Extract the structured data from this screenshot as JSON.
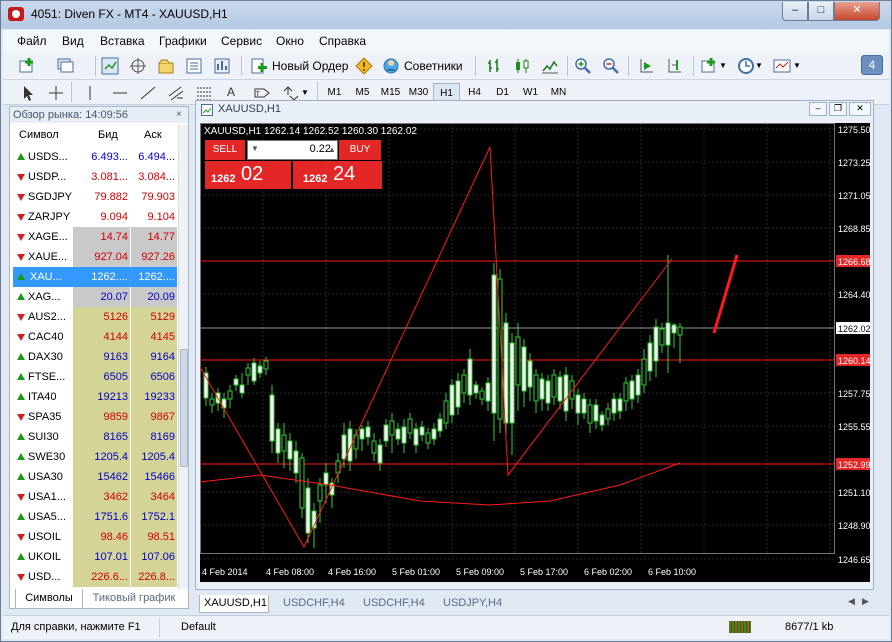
{
  "window": {
    "title": "4051: Diven FX - MT4 - XAUUSD,H1"
  },
  "menu": [
    "Файл",
    "Вид",
    "Вставка",
    "Графики",
    "Сервис",
    "Окно",
    "Справка"
  ],
  "toolbar": {
    "new_order": "Новый Ордер",
    "advisors": "Советники",
    "notifications_count": "4"
  },
  "timeframes": [
    "M1",
    "M5",
    "M15",
    "M30",
    "H1",
    "H4",
    "D1",
    "W1",
    "MN"
  ],
  "active_timeframe": "H1",
  "market_watch": {
    "header": "Обзор рынка: 14:09:56",
    "columns": {
      "symbol": "Символ",
      "bid": "Бид",
      "ask": "Аск"
    },
    "rows": [
      {
        "symbol": "USDS...",
        "bid": "6.493...",
        "ask": "6.494...",
        "dir": "up",
        "bg": "#ffffff",
        "color": "#0000cc"
      },
      {
        "symbol": "USDP...",
        "bid": "3.081...",
        "ask": "3.084...",
        "dir": "down",
        "bg": "#ffffff",
        "color": "#d00000"
      },
      {
        "symbol": "SGDJPY",
        "bid": "79.882",
        "ask": "79.903",
        "dir": "down",
        "bg": "#ffffff",
        "color": "#d00000"
      },
      {
        "symbol": "ZARJPY",
        "bid": "9.094",
        "ask": "9.104",
        "dir": "down",
        "bg": "#ffffff",
        "color": "#d00000"
      },
      {
        "symbol": "XAGE...",
        "bid": "14.74",
        "ask": "14.77",
        "dir": "down",
        "bg": "#c9c9c9",
        "color": "#d00000"
      },
      {
        "symbol": "XAUE...",
        "bid": "927.04",
        "ask": "927.26",
        "dir": "down",
        "bg": "#c9c9c9",
        "color": "#d00000"
      },
      {
        "symbol": "XAU...",
        "bid": "1262....",
        "ask": "1262....",
        "dir": "up",
        "bg": "#3399ff",
        "color": "#ffffff",
        "selected": true
      },
      {
        "symbol": "XAG...",
        "bid": "20.07",
        "ask": "20.09",
        "dir": "up",
        "bg": "#c9c9c9",
        "color": "#0000cc"
      },
      {
        "symbol": "AUS2...",
        "bid": "5126",
        "ask": "5129",
        "dir": "down",
        "bg": "#d4d497",
        "color": "#d00000"
      },
      {
        "symbol": "CAC40",
        "bid": "4144",
        "ask": "4145",
        "dir": "down",
        "bg": "#d4d497",
        "color": "#d00000"
      },
      {
        "symbol": "DAX30",
        "bid": "9163",
        "ask": "9164",
        "dir": "up",
        "bg": "#d4d497",
        "color": "#0000cc"
      },
      {
        "symbol": "FTSE...",
        "bid": "6505",
        "ask": "6506",
        "dir": "up",
        "bg": "#d4d497",
        "color": "#0000cc"
      },
      {
        "symbol": "ITA40",
        "bid": "19213",
        "ask": "19233",
        "dir": "up",
        "bg": "#d4d497",
        "color": "#0000cc"
      },
      {
        "symbol": "SPA35",
        "bid": "9859",
        "ask": "9867",
        "dir": "down",
        "bg": "#d4d497",
        "color": "#d00000"
      },
      {
        "symbol": "SUI30",
        "bid": "8165",
        "ask": "8169",
        "dir": "up",
        "bg": "#d4d497",
        "color": "#0000cc"
      },
      {
        "symbol": "SWE30",
        "bid": "1205.4",
        "ask": "1205.4",
        "dir": "up",
        "bg": "#d4d497",
        "color": "#0000cc"
      },
      {
        "symbol": "USA30",
        "bid": "15462",
        "ask": "15466",
        "dir": "up",
        "bg": "#d4d497",
        "color": "#0000cc"
      },
      {
        "symbol": "USA1...",
        "bid": "3462",
        "ask": "3464",
        "dir": "down",
        "bg": "#d4d497",
        "color": "#d00000"
      },
      {
        "symbol": "USA5...",
        "bid": "1751.6",
        "ask": "1752.1",
        "dir": "up",
        "bg": "#d4d497",
        "color": "#0000cc"
      },
      {
        "symbol": "USOIL",
        "bid": "98.46",
        "ask": "98.51",
        "dir": "down",
        "bg": "#d4d497",
        "color": "#d00000"
      },
      {
        "symbol": "UKOIL",
        "bid": "107.01",
        "ask": "107.06",
        "dir": "up",
        "bg": "#d4d497",
        "color": "#0000cc"
      },
      {
        "symbol": "USD...",
        "bid": "226.6...",
        "ask": "226.8...",
        "dir": "down",
        "bg": "#d4d497",
        "color": "#d00000"
      }
    ],
    "tabs": [
      "Символы",
      "Тиковый график"
    ]
  },
  "chart_window": {
    "title": "XAUUSD,H1"
  },
  "chart": {
    "info_line": "XAUUSD,H1  1262.14 1262.52 1260.30 1262.02",
    "sell_label": "SELL",
    "buy_label": "BUY",
    "volume": "0.22",
    "sell_price_small": "1262",
    "sell_price_big": "02",
    "buy_price_small": "1262",
    "buy_price_big": "24",
    "y_ticks": [
      "1275.50",
      "1273.25",
      "1271.05",
      "1268.85",
      "1266.68",
      "1264.40",
      "1262.02",
      "1260.14",
      "1257.75",
      "1255.55",
      "1252.99",
      "1251.10",
      "1248.90",
      "1246.65"
    ],
    "x_ticks": [
      "4 Feb 2014",
      "4 Feb 08:00",
      "4 Feb 16:00",
      "5 Feb 01:00",
      "5 Feb 09:00",
      "5 Feb 17:00",
      "6 Feb 02:00",
      "6 Feb 10:00"
    ],
    "highlight_levels": [
      "1266.68",
      "1262.02",
      "1260.14",
      "1252.99"
    ],
    "colors": {
      "bull": "#33cc33",
      "bear": "#ffffff",
      "line": "#ff1a1a",
      "grid": "#2a2a2a"
    }
  },
  "chart_tabs": [
    "XAUUSD,H1",
    "USDCHF,H4",
    "USDCHF,H4",
    "USDJPY,H4"
  ],
  "status": {
    "help": "Для справки, нажмите F1",
    "profile": "Default",
    "traffic": "8677/1 kb"
  }
}
